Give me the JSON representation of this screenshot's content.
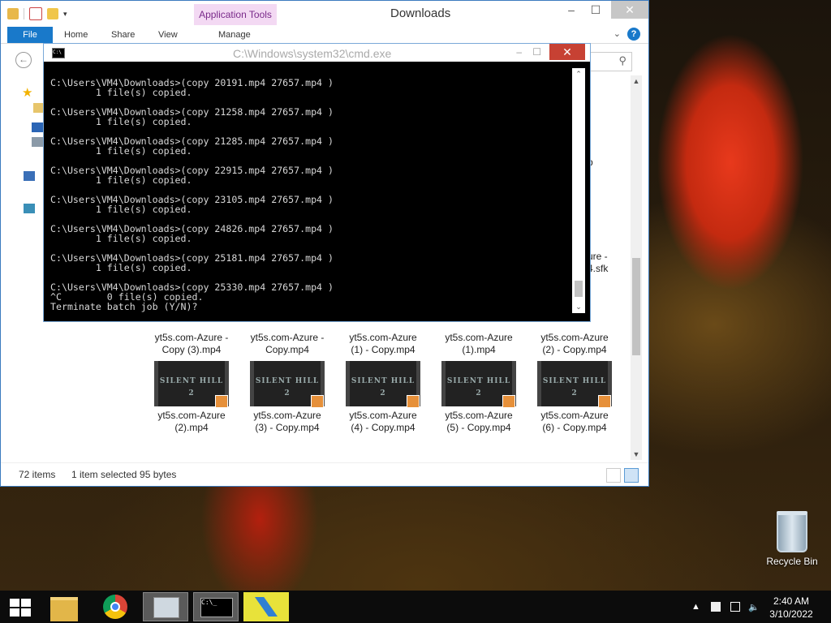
{
  "explorer": {
    "title": "Downloads",
    "app_tools": "Application Tools",
    "tabs": [
      "File",
      "Home",
      "Share",
      "View",
      "Manage"
    ],
    "help": "?",
    "status": {
      "count": "72 items",
      "selected": "1 item selected  95 bytes"
    },
    "partial_labels": {
      "p": "p",
      "sfk1": "ure -",
      "sfk2": "4.sfk"
    },
    "files": [
      {
        "name1": "yt5s.com-Azure -",
        "name2": "Copy (3).mp4"
      },
      {
        "name1": "yt5s.com-Azure -",
        "name2": "Copy.mp4"
      },
      {
        "name1": "yt5s.com-Azure",
        "name2": "(1) - Copy.mp4"
      },
      {
        "name1": "yt5s.com-Azure",
        "name2": "(1).mp4"
      },
      {
        "name1": "yt5s.com-Azure",
        "name2": "(2) - Copy.mp4"
      },
      {
        "name1": "yt5s.com-Azure",
        "name2": "(2).mp4"
      },
      {
        "name1": "yt5s.com-Azure",
        "name2": "(3) - Copy.mp4"
      },
      {
        "name1": "yt5s.com-Azure",
        "name2": "(4) - Copy.mp4"
      },
      {
        "name1": "yt5s.com-Azure",
        "name2": "(5) - Copy.mp4"
      },
      {
        "name1": "yt5s.com-Azure",
        "name2": "(6) - Copy.mp4"
      }
    ],
    "thumb_text": "SILENT HILL 2"
  },
  "cmd": {
    "title": "C:\\Windows\\system32\\cmd.exe",
    "lines": [
      "C:\\Users\\VM4\\Downloads>(copy 20191.mp4 27657.mp4 )",
      "        1 file(s) copied.",
      "",
      "C:\\Users\\VM4\\Downloads>(copy 21258.mp4 27657.mp4 )",
      "        1 file(s) copied.",
      "",
      "C:\\Users\\VM4\\Downloads>(copy 21285.mp4 27657.mp4 )",
      "        1 file(s) copied.",
      "",
      "C:\\Users\\VM4\\Downloads>(copy 22915.mp4 27657.mp4 )",
      "        1 file(s) copied.",
      "",
      "C:\\Users\\VM4\\Downloads>(copy 23105.mp4 27657.mp4 )",
      "        1 file(s) copied.",
      "",
      "C:\\Users\\VM4\\Downloads>(copy 24826.mp4 27657.mp4 )",
      "        1 file(s) copied.",
      "",
      "C:\\Users\\VM4\\Downloads>(copy 25181.mp4 27657.mp4 )",
      "        1 file(s) copied.",
      "",
      "C:\\Users\\VM4\\Downloads>(copy 25330.mp4 27657.mp4 )",
      "^C        0 file(s) copied.",
      "Terminate batch job (Y/N)?"
    ]
  },
  "desktop": {
    "recycle_bin": "Recycle Bin"
  },
  "taskbar": {
    "time": "2:40 AM",
    "date": "3/10/2022"
  }
}
